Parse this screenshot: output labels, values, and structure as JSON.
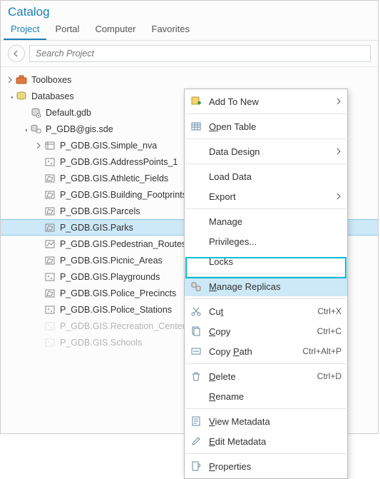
{
  "title": "Catalog",
  "tabs": [
    "Project",
    "Portal",
    "Computer",
    "Favorites"
  ],
  "search_placeholder": "Search Project",
  "tree": {
    "toolboxes": "Toolboxes",
    "databases": "Databases",
    "default_gdb": "Default.gdb",
    "sde": "P_GDB@gis.sde",
    "layers": [
      "P_GDB.GIS.Simple_nva",
      "P_GDB.GIS.AddressPoints_1",
      "P_GDB.GIS.Athletic_Fields",
      "P_GDB.GIS.Building_Footprints",
      "P_GDB.GIS.Parcels",
      "P_GDB.GIS.Parks",
      "P_GDB.GIS.Pedestrian_Routes",
      "P_GDB.GIS.Picnic_Areas",
      "P_GDB.GIS.Playgrounds",
      "P_GDB.GIS.Police_Precincts",
      "P_GDB.GIS.Police_Stations",
      "P_GDB.GIS.Recreation_Centers",
      "P_GDB.GIS.Schools"
    ]
  },
  "ctx": {
    "add_to_new": "Add To New",
    "open_table": "Open Table",
    "data_design": "Data Design",
    "load_data": "Load Data",
    "export": "Export",
    "manage": "Manage",
    "privileges": "Privileges...",
    "locks": "Locks",
    "manage_replicas": "Manage Replicas",
    "cut": "Cut",
    "copy": "Copy",
    "copy_path": "Copy Path",
    "delete": "Delete",
    "rename": "Rename",
    "view_metadata": "View Metadata",
    "edit_metadata": "Edit Metadata",
    "properties": "Properties",
    "sc_cut": "Ctrl+X",
    "sc_copy": "Ctrl+C",
    "sc_copy_path": "Ctrl+Alt+P",
    "sc_delete": "Ctrl+D"
  }
}
